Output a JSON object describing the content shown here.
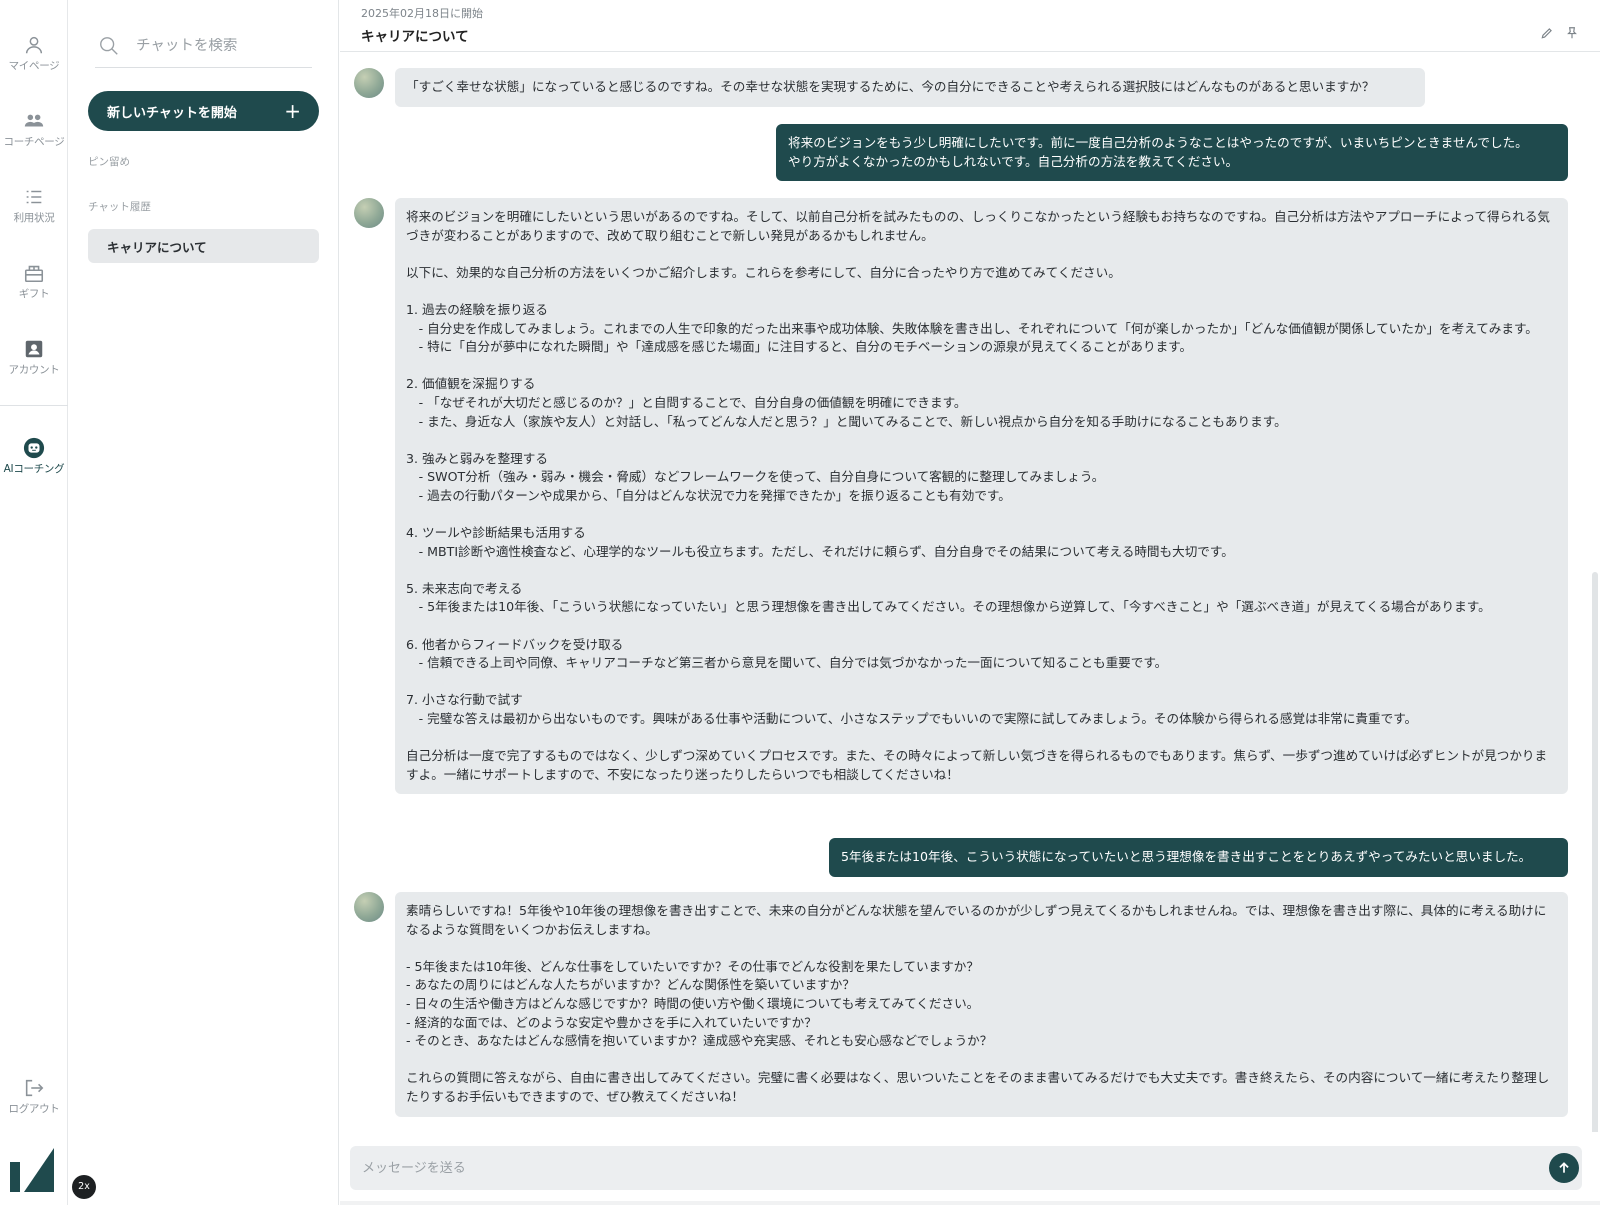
{
  "rail": {
    "items": [
      {
        "label": "マイページ",
        "icon": "person-icon"
      },
      {
        "label": "コーチページ",
        "icon": "people-icon"
      },
      {
        "label": "利用状況",
        "icon": "list-icon"
      },
      {
        "label": "ギフト",
        "icon": "gift-icon"
      },
      {
        "label": "アカウント",
        "icon": "account-icon"
      },
      {
        "label": "AIコーチング",
        "icon": "robot-icon"
      },
      {
        "label": "ログアウト",
        "icon": "logout-icon"
      }
    ],
    "badge": "2x",
    "logo": "app-logo"
  },
  "panel": {
    "search_placeholder": "チャットを検索",
    "new_chat_label": "新しいチャットを開始",
    "new_chat_icon": "+",
    "pinned_label": "ピン留め",
    "history_label": "チャット履歴",
    "history": [
      {
        "title": "キャリアについて"
      }
    ]
  },
  "header": {
    "date": "2025年02月18日に開始",
    "title": "キャリアについて"
  },
  "messages": [
    {
      "role": "ai",
      "text": "「すごく幸せな状態」になっていると感じるのですね。その幸せな状態を実現するために、今の自分にできることや考えられる選択肢にはどんなものがあると思いますか？"
    },
    {
      "role": "user",
      "text": "将来のビジョンをもう少し明確にしたいです。前に一度自己分析のようなことはやったのですが、いまいちピンときませんでした。\nやり方がよくなかったのかもしれないです。自己分析の方法を教えてください。"
    },
    {
      "role": "ai",
      "text": "将来のビジョンを明確にしたいという思いがあるのですね。そして、以前自己分析を試みたものの、しっくりこなかったという経験もお持ちなのですね。自己分析は方法やアプローチによって得られる気づきが変わることがありますので、改めて取り組むことで新しい発見があるかもしれません。\n\n以下に、効果的な自己分析の方法をいくつかご紹介します。これらを参考にして、自分に合ったやり方で進めてみてください。\n\n1. 過去の経験を振り返る\n　- 自分史を作成してみましょう。これまでの人生で印象的だった出来事や成功体験、失敗体験を書き出し、それぞれについて「何が楽しかったか」「どんな価値観が関係していたか」を考えてみます。\n　- 特に「自分が夢中になれた瞬間」や「達成感を感じた場面」に注目すると、自分のモチベーションの源泉が見えてくることがあります。\n\n2. 価値観を深掘りする\n　- 「なぜそれが大切だと感じるのか？」と自問することで、自分自身の価値観を明確にできます。\n　- また、身近な人（家族や友人）と対話し、「私ってどんな人だと思う？」と聞いてみることで、新しい視点から自分を知る手助けになることもあります。\n\n3. 強みと弱みを整理する\n　- SWOT分析（強み・弱み・機会・脅威）などフレームワークを使って、自分自身について客観的に整理してみましょう。\n　- 過去の行動パターンや成果から、「自分はどんな状況で力を発揮できたか」を振り返ることも有効です。\n\n4. ツールや診断結果も活用する\n　- MBTI診断や適性検査など、心理学的なツールも役立ちます。ただし、それだけに頼らず、自分自身でその結果について考える時間も大切です。\n\n5. 未来志向で考える\n　- 5年後または10年後、「こういう状態になっていたい」と思う理想像を書き出してみてください。その理想像から逆算して、「今すべきこと」や「選ぶべき道」が見えてくる場合があります。\n\n6. 他者からフィードバックを受け取る\n　- 信頼できる上司や同僚、キャリアコーチなど第三者から意見を聞いて、自分では気づかなかった一面について知ることも重要です。\n\n7. 小さな行動で試す\n　- 完璧な答えは最初から出ないものです。興味がある仕事や活動について、小さなステップでもいいので実際に試してみましょう。その体験から得られる感覚は非常に貴重です。\n\n自己分析は一度で完了するものではなく、少しずつ深めていくプロセスです。また、その時々によって新しい気づきを得られるものでもあります。焦らず、一歩ずつ進めていけば必ずヒントが見つかりますよ。一緒にサポートしますので、不安になったり迷ったりしたらいつでも相談してくださいね！"
    },
    {
      "role": "user",
      "text": "5年後または10年後、こういう状態になっていたいと思う理想像を書き出すことをとりあえずやってみたいと思いました。"
    },
    {
      "role": "ai",
      "text": "素晴らしいですね！5年後や10年後の理想像を書き出すことで、未来の自分がどんな状態を望んでいるのかが少しずつ見えてくるかもしれませんね。では、理想像を書き出す際に、具体的に考える助けになるような質問をいくつかお伝えしますね。\n\n- 5年後または10年後、どんな仕事をしていたいですか？その仕事でどんな役割を果たしていますか？\n- あなたの周りにはどんな人たちがいますか？どんな関係性を築いていますか？\n- 日々の生活や働き方はどんな感じですか？時間の使い方や働く環境についても考えてみてください。\n- 経済的な面では、どのような安定や豊かさを手に入れていたいですか？\n- そのとき、あなたはどんな感情を抱いていますか？達成感や充実感、それとも安心感などでしょうか？\n\nこれらの質問に答えながら、自由に書き出してみてください。完璧に書く必要はなく、思いついたことをそのまま書いてみるだけでも大丈夫です。書き終えたら、その内容について一緒に考えたり整理したりするお手伝いもできますので、ぜひ教えてくださいね！"
    }
  ],
  "composer": {
    "placeholder": "メッセージを送る",
    "send_icon": "arrow-up-icon"
  },
  "colors": {
    "accent": "#1f4a4d",
    "ai_bubble": "#e7eaec",
    "user_bubble": "#1f4a4d"
  }
}
